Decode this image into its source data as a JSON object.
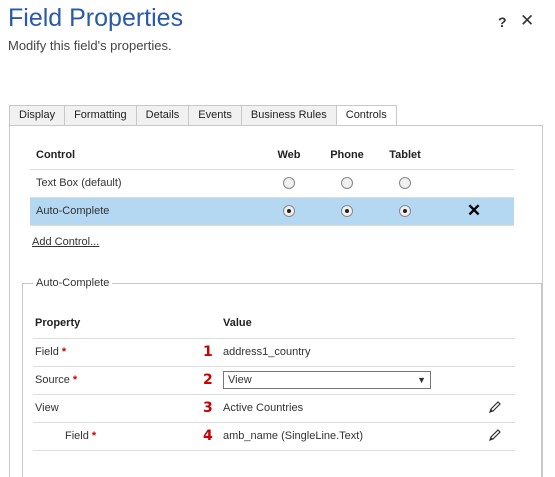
{
  "dialog": {
    "title": "Field Properties",
    "subtitle": "Modify this field's properties.",
    "help_icon": "?",
    "close_icon": "✕"
  },
  "tabs": [
    {
      "label": "Display",
      "active": false
    },
    {
      "label": "Formatting",
      "active": false
    },
    {
      "label": "Details",
      "active": false
    },
    {
      "label": "Events",
      "active": false
    },
    {
      "label": "Business Rules",
      "active": false
    },
    {
      "label": "Controls",
      "active": true
    }
  ],
  "controls_table": {
    "headers": {
      "control": "Control",
      "web": "Web",
      "phone": "Phone",
      "tablet": "Tablet"
    },
    "rows": [
      {
        "name": "Text Box (default)",
        "web": false,
        "phone": false,
        "tablet": false,
        "selected": false
      },
      {
        "name": "Auto-Complete",
        "web": true,
        "phone": true,
        "tablet": true,
        "selected": true,
        "remove_icon": "✕"
      }
    ]
  },
  "add_control_label": "Add Control...",
  "autocomplete": {
    "legend": "Auto-Complete",
    "headers": {
      "property": "Property",
      "value": "Value"
    },
    "rows": [
      {
        "property": "Field",
        "required": "*",
        "number": "1",
        "value": "address1_country"
      },
      {
        "property": "Source",
        "required": "*",
        "number": "2",
        "value": "View"
      },
      {
        "property": "View",
        "number": "3",
        "value": "Active Countries"
      },
      {
        "property": "Field",
        "required": "*",
        "number": "4",
        "value": "amb_name (SingleLine.Text)"
      }
    ],
    "select_arrow": "▼"
  },
  "icons": {
    "edit": "pencil-icon",
    "remove": "close-icon",
    "help": "help-icon"
  }
}
